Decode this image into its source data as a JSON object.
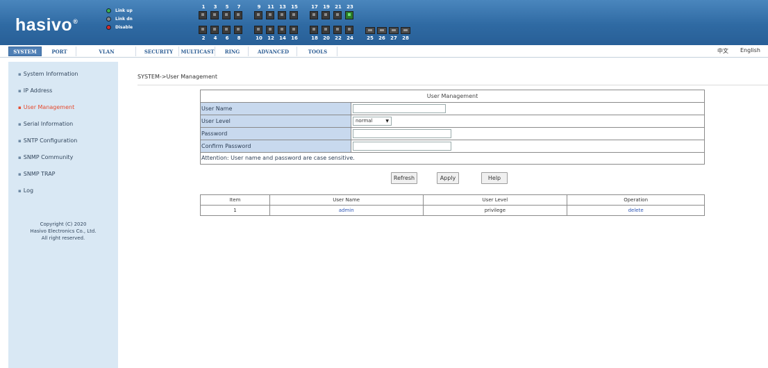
{
  "header": {
    "logo": "hasivo",
    "logo_mark": "®",
    "legend": [
      {
        "label": "Link up",
        "color": "#3cb04a"
      },
      {
        "label": "Link dn",
        "color": "#8a8a8a"
      },
      {
        "label": "Disable",
        "color": "#d42a2a"
      }
    ],
    "ports_top_labels": [
      "1",
      "3",
      "5",
      "7",
      "9",
      "11",
      "13",
      "15",
      "17",
      "19",
      "21",
      "23"
    ],
    "ports_bottom_labels": [
      "2",
      "4",
      "6",
      "8",
      "10",
      "12",
      "14",
      "16",
      "18",
      "20",
      "22",
      "24",
      "25",
      "26",
      "27",
      "28"
    ],
    "link_up_ports": [
      "23"
    ]
  },
  "nav": {
    "tabs": [
      {
        "label": "SYSTEM",
        "active": true
      },
      {
        "label": "PORT"
      },
      {
        "label": "VLAN"
      },
      {
        "label": "SECURITY"
      },
      {
        "label": "MULTICAST"
      },
      {
        "label": "RING"
      },
      {
        "label": "ADVANCED"
      },
      {
        "label": "TOOLS"
      }
    ],
    "lang_cn": "中文",
    "lang_en": "English"
  },
  "sidebar": {
    "items": [
      {
        "label": "System Information"
      },
      {
        "label": "IP Address"
      },
      {
        "label": "User Management",
        "active": true
      },
      {
        "label": "Serial Information"
      },
      {
        "label": "SNTP Configuration"
      },
      {
        "label": "SNMP Community"
      },
      {
        "label": "SNMP TRAP"
      },
      {
        "label": "Log"
      }
    ],
    "copyright_line1": "Copyright (C) 2020",
    "copyright_line2": "Hasivo Electronics Co., Ltd.",
    "copyright_line3": "All right reserved."
  },
  "breadcrumb": "SYSTEM->User Management",
  "user_form": {
    "title": "User Management",
    "user_name_label": "User Name",
    "user_name_value": "",
    "user_level_label": "User Level",
    "user_level_value": "normal",
    "password_label": "Password",
    "password_value": "",
    "confirm_password_label": "Confirm Password",
    "confirm_password_value": "",
    "attention": "Attention: User name and password are case sensitive."
  },
  "buttons": {
    "refresh": "Refresh",
    "apply": "Apply",
    "help": "Help"
  },
  "users_table": {
    "headers": [
      "Item",
      "User Name",
      "User Level",
      "Operation"
    ],
    "rows": [
      {
        "item": "1",
        "user_name": "admin",
        "user_level": "privilege",
        "operation": "delete"
      }
    ]
  }
}
